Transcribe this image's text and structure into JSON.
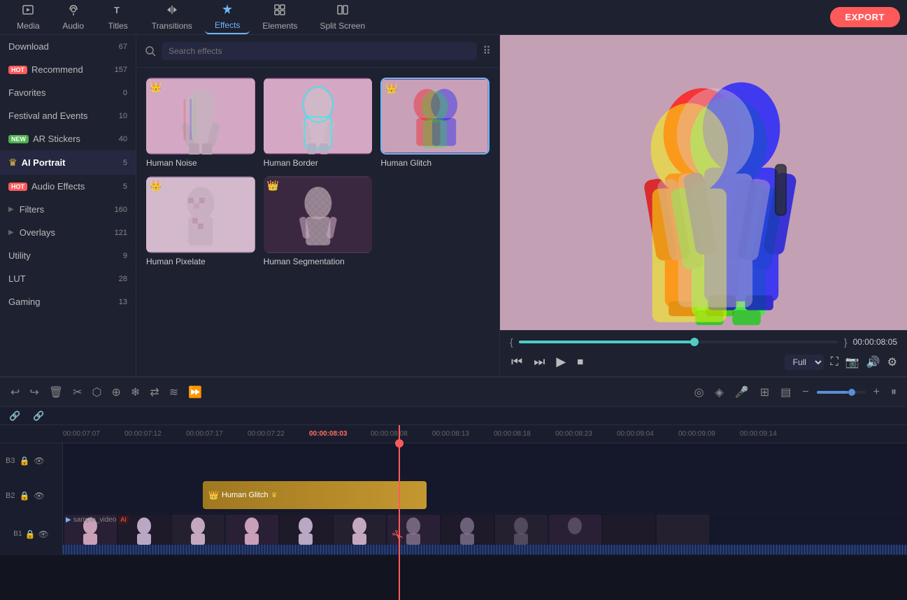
{
  "topNav": {
    "items": [
      {
        "id": "media",
        "label": "Media",
        "icon": "⬜"
      },
      {
        "id": "audio",
        "label": "Audio",
        "icon": "♪"
      },
      {
        "id": "titles",
        "label": "Titles",
        "icon": "T"
      },
      {
        "id": "transitions",
        "label": "Transitions",
        "icon": "⇄"
      },
      {
        "id": "effects",
        "label": "Effects",
        "icon": "✦",
        "active": true
      },
      {
        "id": "elements",
        "label": "Elements",
        "icon": "❖"
      },
      {
        "id": "splitscreen",
        "label": "Split Screen",
        "icon": "▣"
      }
    ],
    "exportLabel": "EXPORT"
  },
  "sidebar": {
    "items": [
      {
        "id": "download",
        "label": "Download",
        "count": "67",
        "badge": null
      },
      {
        "id": "recommend",
        "label": "Recommend",
        "count": "157",
        "badge": "hot"
      },
      {
        "id": "favorites",
        "label": "Favorites",
        "count": "0",
        "badge": null
      },
      {
        "id": "festival",
        "label": "Festival and Events",
        "count": "10",
        "badge": null
      },
      {
        "id": "ar-stickers",
        "label": "AR Stickers",
        "count": "40",
        "badge": "new"
      },
      {
        "id": "ai-portrait",
        "label": "AI Portrait",
        "count": "5",
        "badge": null,
        "active": true
      },
      {
        "id": "audio-effects",
        "label": "Audio Effects",
        "count": "5",
        "badge": "hot"
      },
      {
        "id": "filters",
        "label": "Filters",
        "count": "160",
        "badge": null,
        "expandable": true
      },
      {
        "id": "overlays",
        "label": "Overlays",
        "count": "121",
        "badge": null,
        "expandable": true
      },
      {
        "id": "utility",
        "label": "Utility",
        "count": "9",
        "badge": null
      },
      {
        "id": "lut",
        "label": "LUT",
        "count": "28",
        "badge": null
      },
      {
        "id": "gaming",
        "label": "Gaming",
        "count": "13",
        "badge": null
      }
    ]
  },
  "effectsPanel": {
    "searchPlaceholder": "Search effects",
    "effects": [
      {
        "id": "human-noise",
        "label": "Human Noise",
        "crown": true,
        "bg": "#7a5888"
      },
      {
        "id": "human-border",
        "label": "Human Border",
        "crown": false,
        "bg": "#5a3060"
      },
      {
        "id": "human-glitch",
        "label": "Human Glitch",
        "crown": true,
        "bg": "#6a4070",
        "selected": true
      },
      {
        "id": "human-pixelate",
        "label": "Human Pixelate",
        "crown": true,
        "bg": "#6a5878"
      },
      {
        "id": "human-segmentation",
        "label": "Human Segmentation",
        "crown": true,
        "bg": "#4a3855"
      }
    ]
  },
  "preview": {
    "timeCode": "00:00:08:05",
    "progressPercent": 55,
    "quality": "Full"
  },
  "timeline": {
    "tracks": [
      {
        "id": "track3",
        "label": "B3",
        "type": "effect"
      },
      {
        "id": "track2",
        "label": "B2",
        "type": "effect-clip"
      },
      {
        "id": "track1",
        "label": "B1",
        "type": "video"
      }
    ],
    "rulerMarks": [
      "00:00:07:07",
      "00:00:07:12",
      "00:00:07:17",
      "00:00:07:22",
      "00:00:08:03",
      "00:00:08:08",
      "00:00:08:13",
      "00:00:08:18",
      "00:00:08:23",
      "00:00:09:04",
      "00:00:09:09",
      "00:00:09:14"
    ],
    "effectClipLabel": "Human Glitch",
    "videoLabel": "sample_video",
    "playheadPosition": "37%"
  }
}
